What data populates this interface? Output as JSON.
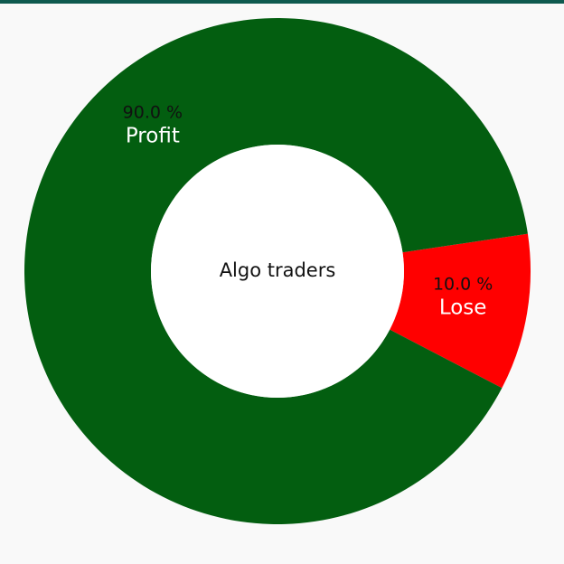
{
  "window": {
    "accent_color": "#0f5a4f",
    "background_color": "#f9f9f9"
  },
  "chart_data": {
    "type": "pie",
    "donut": true,
    "center_label": "Algo traders",
    "slices": [
      {
        "name": "Lose",
        "value": 10.0,
        "percent_label": "10.0 %",
        "color": "#ff0000"
      },
      {
        "name": "Profit",
        "value": 90.0,
        "percent_label": "90.0 %",
        "color": "#035e10"
      }
    ],
    "title": "",
    "legend": "none"
  }
}
